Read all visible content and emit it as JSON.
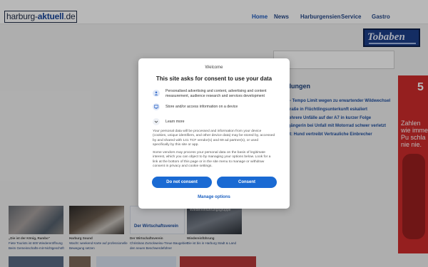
{
  "header": {
    "logo": {
      "part1": "harburg-",
      "part2": "aktuell",
      "part3": ".de"
    },
    "nav": [
      {
        "label": "Home",
        "active": true
      },
      {
        "label": "News",
        "active": false
      },
      {
        "label": "Harburgensien",
        "active": false
      },
      {
        "label": "Service",
        "active": false
      },
      {
        "label": "Gastro",
        "active": false
      }
    ]
  },
  "sidebar": {
    "ad_tobaben": "Tobaben",
    "meldungen_title": "ldungen",
    "meldungen": [
      "B - Tempo Limit wegen zu erwartender Wildwechsel",
      "Straße in Flüchtlingsunterkunft eskaliert",
      "Mehrere Unfälle auf der A7 in kurzer Folge",
      "ßgängerin bei Unfall mit Motorrad schwer verletzt",
      "ort: Hund vertreibt Vertrauliche Einbrecher"
    ],
    "right_ad_text": [
      "Zahlen",
      "wie imme",
      "Pu schla",
      "nie nie."
    ],
    "right_ad_number": "5"
  },
  "cards": [
    {
      "line1": "„Die ist der König, Rambo\"",
      "line2": "Fiete Tourists ist 600 Wiedereröffnung",
      "line3": "Beim Gemeinschafts-mit-Nichtgeschöft"
    },
    {
      "line1": "Harburg Sound",
      "line2": "Wacht: weekend Karte auf professionelle",
      "line3": "Bewegung setzen"
    },
    {
      "line1": "Der Wirtschaftsverein",
      "line2": "Christinas Zurückweisu-Treue Baugebiet",
      "line3": "den neuen Beschwerdeführer"
    },
    {
      "line1": "Wiedereinführung",
      "line2": "Die ist bis in Harburg Stadt & Land",
      "line3": ""
    }
  ],
  "card_overlays": {
    "card3_label": "Der Wirtschaftsverein",
    "card4_label": "Wiedereinführungsgruppe"
  },
  "consent": {
    "welcome": "Welcome",
    "title": "This site asks for consent to use your data",
    "purposes": [
      "Personalised advertising and content, advertising and content measurement, audience research and services development",
      "Store and/or access information on a device"
    ],
    "learn_more": "Learn more",
    "body1": "Your personal data will be processed and information from your device (cookies, unique identifiers, and other device data) may be stored by, accessed by and shared with 141 TCF vendor(s) and 69 ad partner(s), or used specifically by this site or app.",
    "body2": "Some vendors may process your personal data on the basis of legitimate interest, which you can object to by managing your options below. Look for a link at the bottom of this page or in the site menu to manage or withdraw consent in privacy and cookie settings.",
    "btn_reject": "Do not consent",
    "btn_accept": "Consent",
    "manage": "Manage options"
  },
  "colors": {
    "accent": "#1a6ad3",
    "nav": "#274a8a",
    "ad_red": "#cf2b2b"
  }
}
